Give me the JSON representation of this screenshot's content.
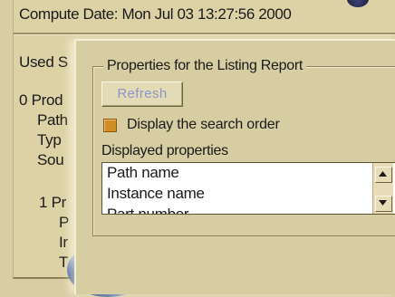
{
  "report": {
    "compute_date": "Compute Date: Mon Jul 03 13:27:56 2000",
    "lines": [
      "Used S",
      "0 Prod",
      "Path",
      "Typ",
      "Sou",
      "1 Pr",
      "P",
      "Ir",
      "T"
    ]
  },
  "dialog": {
    "group_title": "Properties for the Listing Report",
    "refresh_label": "Refresh",
    "checkbox_label": "Display the search order",
    "displayed_label": "Displayed properties",
    "properties": [
      "Path name",
      "Instance name",
      "Part number"
    ]
  },
  "icons": {
    "scroll_up": "scroll-up-arrow-icon",
    "scroll_down": "scroll-down-arrow-icon"
  },
  "colors": {
    "background": "#d8cda5",
    "checkbox": "#d18d24",
    "disabled_text": "#8d96c9"
  }
}
